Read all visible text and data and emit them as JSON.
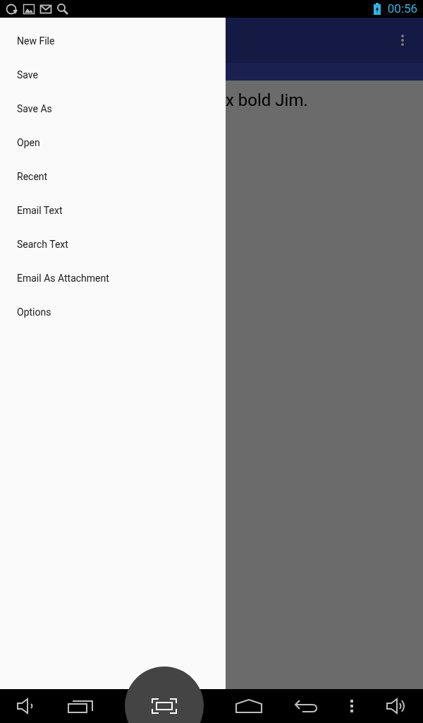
{
  "status_bar": {
    "time": "00:56"
  },
  "drawer": {
    "items": [
      {
        "label": "New File"
      },
      {
        "label": "Save"
      },
      {
        "label": "Save As"
      },
      {
        "label": "Open"
      },
      {
        "label": "Recent"
      },
      {
        "label": "Email Text"
      },
      {
        "label": "Search Text"
      },
      {
        "label": "Email As Attachment"
      },
      {
        "label": "Options"
      }
    ]
  },
  "content": {
    "text": "x bold Jim."
  }
}
